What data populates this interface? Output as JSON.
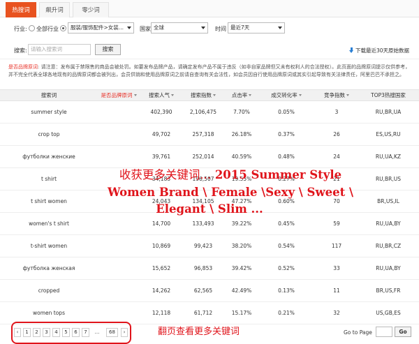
{
  "tabs": [
    {
      "label": "热搜词",
      "active": true
    },
    {
      "label": "飙升词",
      "active": false
    },
    {
      "label": "零少词",
      "active": false
    }
  ],
  "filters": {
    "industry_label": "行业:",
    "all_industry": "全部行业",
    "category_value": "服装/服饰配件>女装...",
    "country_label": "国家",
    "country_value": "全球",
    "time_label": "时间",
    "time_value": "最近7天"
  },
  "search": {
    "label": "搜索:",
    "placeholder": "请输入搜索词",
    "button": "搜索",
    "download": "下载最近30天原始数据"
  },
  "notice": {
    "title": "是否品牌原词",
    "text": ": 请注意：发布属于禁限售的商品会被处罚。如要发布品牌产品，请确定发布产品不属于违反（如非自家品牌但又未有权利人的合法授权）。此页面的品牌原词提示仅供参考，并不完全代表全球各地现有的品牌原词都会被列出，会员供销和使用品牌原词之前请自查询有关会法性，如会员因自行使用品牌原词或其实引起导致有关法律责任，阿里巴巴不承担之。"
  },
  "table": {
    "headers": [
      "搜索词",
      "是否品牌原词",
      "搜索人气",
      "搜索指数",
      "点击率",
      "成交转化率",
      "竞争指数",
      "TOP3热搜国家"
    ],
    "rows": [
      [
        "summer style",
        "",
        "402,390",
        "2,106,475",
        "7.70%",
        "0.05%",
        "3",
        "RU,BR,UA"
      ],
      [
        "crop top",
        "",
        "49,702",
        "257,318",
        "26.18%",
        "0.37%",
        "26",
        "ES,US,RU"
      ],
      [
        "футболки женские",
        "",
        "39,761",
        "252,014",
        "40.59%",
        "0.48%",
        "24",
        "RU,UA,KZ"
      ],
      [
        "t shirt",
        "",
        "34,183",
        "196,507",
        "19.55%",
        "0.27%",
        "21",
        "RU,BR,US"
      ],
      [
        "t shirt women",
        "",
        "24,043",
        "134,105",
        "47.27%",
        "0.60%",
        "70",
        "BR,US,IL"
      ],
      [
        "women's t shirt",
        "",
        "14,700",
        "133,493",
        "39.22%",
        "0.45%",
        "59",
        "RU,UA,BY"
      ],
      [
        "t-shirt women",
        "",
        "10,869",
        "99,423",
        "38.20%",
        "0.54%",
        "117",
        "RU,BR,CZ"
      ],
      [
        "футболка женская",
        "",
        "15,652",
        "96,853",
        "39.42%",
        "0.52%",
        "33",
        "RU,UA,BY"
      ],
      [
        "cropped",
        "",
        "14,262",
        "62,565",
        "42.49%",
        "0.13%",
        "11",
        "BR,US,FR"
      ],
      [
        "women tops",
        "",
        "12,118",
        "61,712",
        "15.17%",
        "0.21%",
        "32",
        "US,GB,ES"
      ]
    ]
  },
  "overlay": {
    "line1_cn": "收获更多关键词...",
    "line1_en": "2015 Summer Style",
    "line2": "Women Brand \\ Female \\Sexy \\ Sweet \\",
    "line3": "Elegant \\ Slim ..."
  },
  "pager": {
    "prev": "‹",
    "pages": [
      "1",
      "2",
      "3",
      "4",
      "5",
      "6",
      "7"
    ],
    "ellipsis": "...",
    "last": "68",
    "next": "›",
    "note": "翻页查看更多关键词",
    "goto_label": "Go to Page",
    "go_button": "Go"
  },
  "colors": {
    "accent": "#e8521f",
    "annotation_red": "#e0141b",
    "brand_red_text": "#e8332a"
  }
}
